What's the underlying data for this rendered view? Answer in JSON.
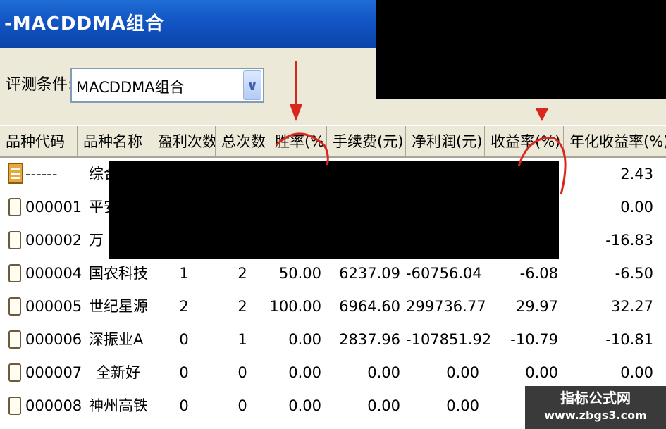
{
  "window": {
    "title": "-MACDDMA组合"
  },
  "toolbar": {
    "condition_label": "评测条件:",
    "condition_value": "MACDDMA组合",
    "dropdown_glyph": "∨"
  },
  "table": {
    "columns": [
      "品种代码",
      "品种名称",
      "盈利次数",
      "总次数",
      "胜率(%)",
      "手续费(元)",
      "净利润(元)",
      "收益率(%)",
      "年化收益率(%)"
    ],
    "rows": [
      {
        "code": "------",
        "name": "综合",
        "wins": "",
        "total": "",
        "win_rate": "",
        "fee": "",
        "net_profit": "",
        "return": "",
        "annual": "2.43",
        "icon": "summary-icon"
      },
      {
        "code": "000001",
        "name": "平安",
        "wins": "",
        "total": "",
        "win_rate": "",
        "fee": "",
        "net_profit": "",
        "return": "",
        "annual": "0.00",
        "icon": "document-icon"
      },
      {
        "code": "000002",
        "name": "万",
        "wins": "",
        "total": "",
        "win_rate": "",
        "fee": "",
        "net_profit": "",
        "return": "",
        "annual": "-16.83",
        "icon": "document-icon"
      },
      {
        "code": "000004",
        "name": "国农科技",
        "wins": "1",
        "total": "2",
        "win_rate": "50.00",
        "fee": "6237.09",
        "net_profit": "-60756.04",
        "return": "-6.08",
        "annual": "-6.50",
        "icon": "document-icon"
      },
      {
        "code": "000005",
        "name": "世纪星源",
        "wins": "2",
        "total": "2",
        "win_rate": "100.00",
        "fee": "6964.60",
        "net_profit": "299736.77",
        "return": "29.97",
        "annual": "32.27",
        "icon": "document-icon"
      },
      {
        "code": "000006",
        "name": "深振业A",
        "wins": "0",
        "total": "1",
        "win_rate": "0.00",
        "fee": "2837.96",
        "net_profit": "-107851.92",
        "return": "-10.79",
        "annual": "-10.81",
        "icon": "document-icon"
      },
      {
        "code": "000007",
        "name": "全新好",
        "wins": "0",
        "total": "0",
        "win_rate": "0.00",
        "fee": "0.00",
        "net_profit": "0.00",
        "return": "0.00",
        "annual": "0.00",
        "icon": "document-icon"
      },
      {
        "code": "000008",
        "name": "神州高铁",
        "wins": "0",
        "total": "0",
        "win_rate": "0.00",
        "fee": "0.00",
        "net_profit": "0.00",
        "return": "0.00",
        "annual": "0.00",
        "icon": "document-icon"
      }
    ]
  },
  "watermark": {
    "title": "指标公式网",
    "url": "www.zbgs3.com"
  },
  "colors": {
    "annotation": "#d9271f",
    "title_bar": "#1255c4",
    "redaction": "#000000"
  }
}
